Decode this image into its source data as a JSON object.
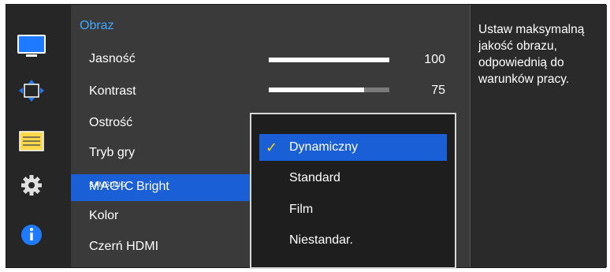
{
  "sidebar": {
    "icons": [
      "monitor-icon",
      "move-arrows-icon",
      "slider-panel-icon",
      "gear-icon",
      "info-icon"
    ]
  },
  "main": {
    "title": "Obraz",
    "items": [
      {
        "label": "Jasność",
        "value": "100",
        "level": 100
      },
      {
        "label": "Kontrast",
        "value": "75",
        "level": 75
      },
      {
        "label": "Ostrość"
      },
      {
        "label": "Tryb gry"
      },
      {
        "label_brand_small": "SAMSUNG",
        "label_brand_big": "MAGIC",
        "label": "Bright"
      },
      {
        "label": "Kolor"
      },
      {
        "label": "Czerń HDMI"
      }
    ]
  },
  "dropdown": {
    "options": [
      "Dynamiczny",
      "Standard",
      "Film",
      "Niestandar."
    ],
    "selected_index": 0,
    "check_glyph": "✓"
  },
  "help": {
    "text": "Ustaw maksymalną jakość obrazu, odpowiednią do warunków pracy."
  },
  "colors": {
    "accent": "#1a5fd6",
    "title": "#3fa8ff",
    "check": "#ffd400"
  }
}
